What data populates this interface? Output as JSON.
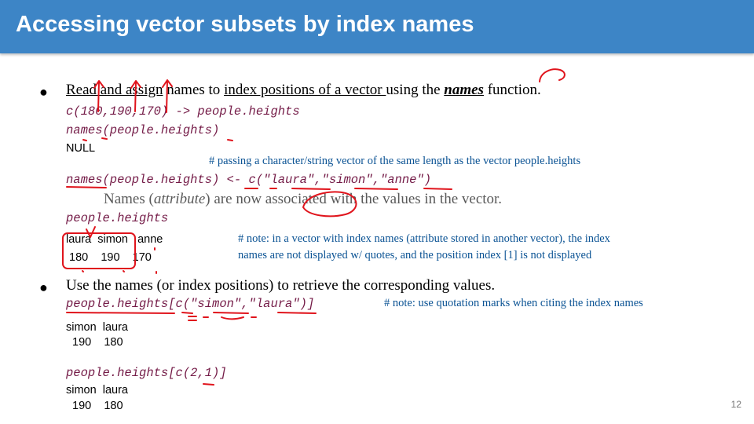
{
  "slide": {
    "title": "Accessing vector subsets by index names",
    "page_number": "12"
  },
  "bullet1": {
    "marker": "●",
    "read_and_assign": "Read and assign",
    "text2": " names to ",
    "index_positions": "index positions of a vector ",
    "text3": "using the ",
    "names_fn": "names",
    "text4": " function."
  },
  "block1": {
    "code1": "c(180,190,170) -> people.heights",
    "code2": "names(people.heights)",
    "out1": "NULL",
    "note1": "# passing a character/string vector of the same length as the vector people.heights",
    "code3": "names(people.heights) <- c(\"laura\",\"simon\",\"anne\")",
    "gray_a": "Names (",
    "gray_attr": "attribute",
    "gray_b": ") are now associated with the values in the vector.",
    "code4": "people.heights",
    "out_names": "laura  simon   anne",
    "out_values": " 180    190    170",
    "note2a": "# note:  in a vector with index names (attribute stored in another vector), the index",
    "note2b": "names are not displayed w/ quotes, and the position  index [1] is not displayed"
  },
  "bullet2": {
    "marker": "●",
    "text": "Use the names (or index positions) to retrieve the corresponding values.",
    "code5": "people.heights[c(\"simon\",\"laura\")]",
    "note3": "# note:  use quotation  marks when citing the index names",
    "out3a": "simon  laura",
    "out3b": "  190    180",
    "code6": "people.heights[c(2,1)]",
    "out4a": "simon  laura",
    "out4b": "  190    180"
  }
}
